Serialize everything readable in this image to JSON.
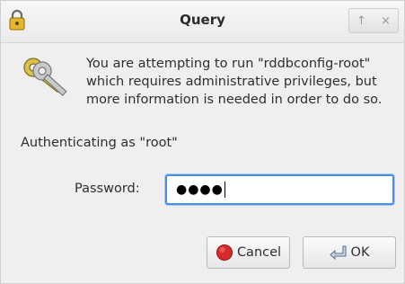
{
  "window": {
    "title": "Query",
    "title_buttons": [
      "↑",
      "×"
    ]
  },
  "message": {
    "text": "You are attempting to run \"rddbconfig-root\"\nwhich requires administrative privileges, but\nmore information is needed in order to do so."
  },
  "auth": {
    "authenticating_as": "Authenticating as \"root\"",
    "password_label": "Password:",
    "password_value": "●●●●"
  },
  "buttons": {
    "cancel_label": "Cancel",
    "ok_label": "OK"
  },
  "icons": {
    "title": "lock-icon",
    "message": "keys-icon",
    "cancel": "cancel-icon",
    "ok": "ok-arrow-icon"
  },
  "colors": {
    "focus_border": "#4a90d9",
    "cancel_icon": "#d92b2b"
  }
}
